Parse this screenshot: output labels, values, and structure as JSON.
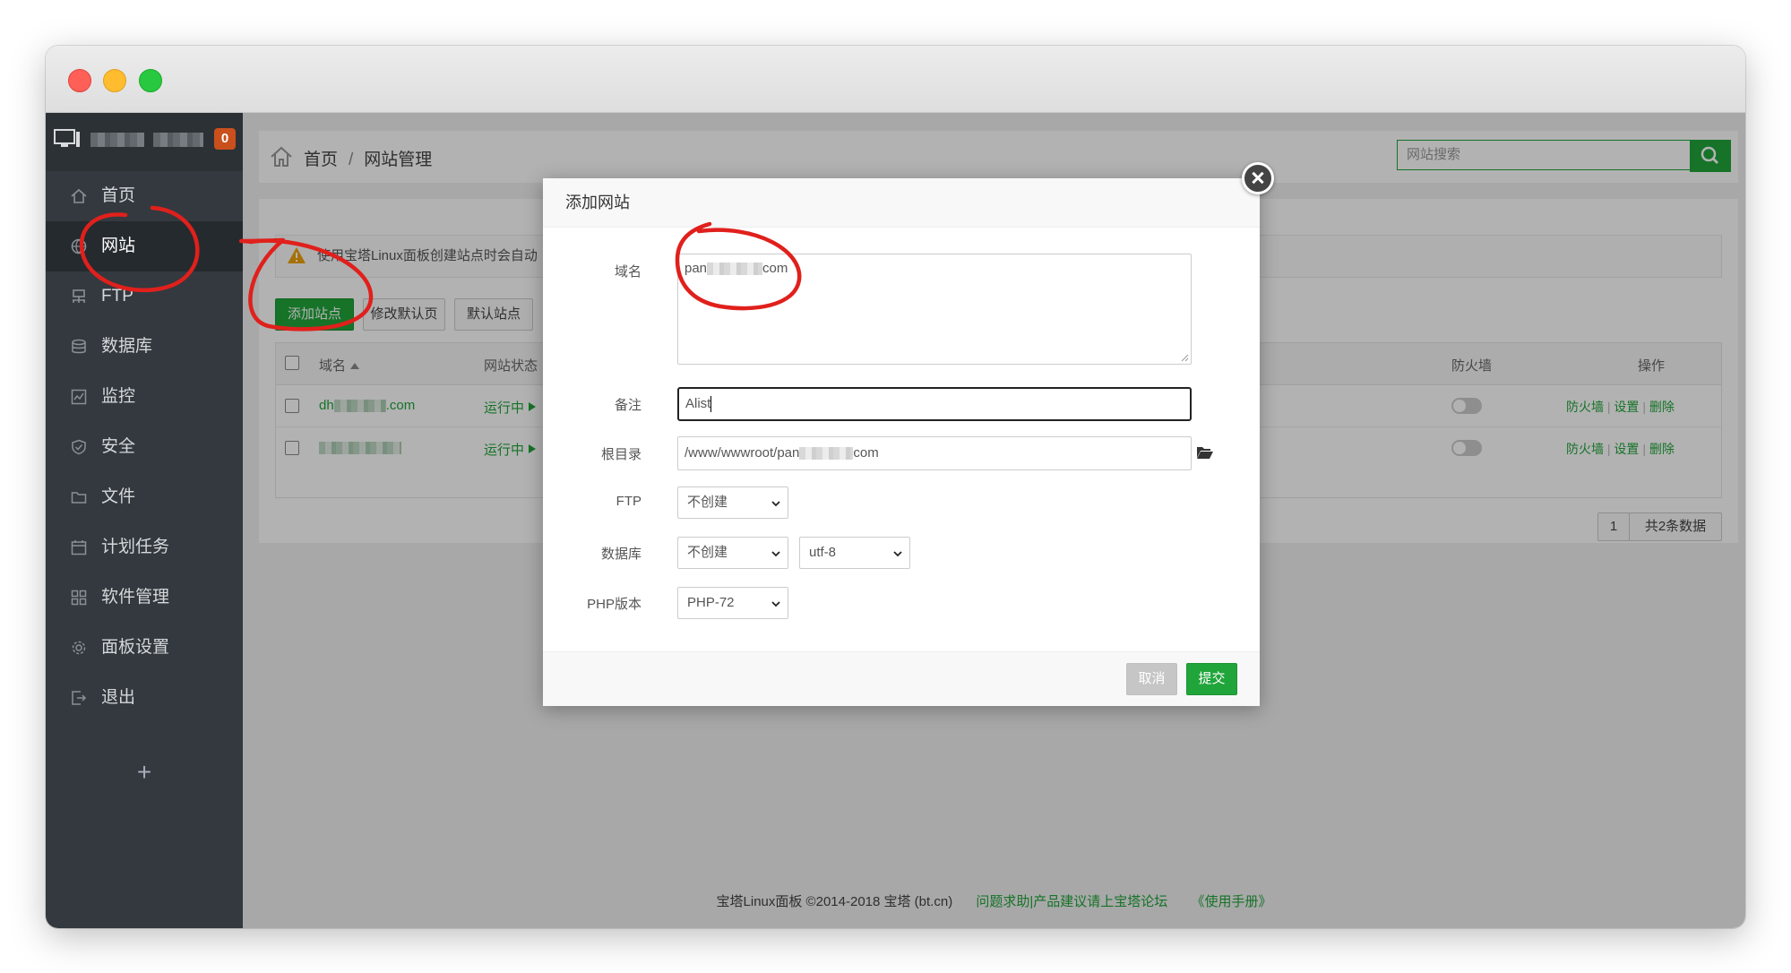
{
  "sidebar": {
    "badge_count": "0",
    "items": [
      {
        "label": "首页"
      },
      {
        "label": "网站"
      },
      {
        "label": "FTP"
      },
      {
        "label": "数据库"
      },
      {
        "label": "监控"
      },
      {
        "label": "安全"
      },
      {
        "label": "文件"
      },
      {
        "label": "计划任务"
      },
      {
        "label": "软件管理"
      },
      {
        "label": "面板设置"
      },
      {
        "label": "退出"
      }
    ],
    "add_symbol": "+"
  },
  "breadcrumb": {
    "home": "首页",
    "separator": "/",
    "current": "网站管理"
  },
  "search": {
    "placeholder": "网站搜索"
  },
  "notice": {
    "text": "使用宝塔Linux面板创建站点时会自动"
  },
  "toolbar": {
    "add_site": "添加站点",
    "edit_default": "修改默认页",
    "default_site": "默认站点"
  },
  "table": {
    "headers": {
      "domain": "域名",
      "status": "网站状态",
      "firewall": "防火墙",
      "actions": "操作"
    },
    "rows": [
      {
        "domain_prefix": "dh",
        "domain_suffix": ".com",
        "status": "运行中",
        "actions": [
          "防火墙",
          "设置",
          "删除"
        ]
      },
      {
        "domain_prefix": "",
        "domain_suffix": "",
        "status": "运行中",
        "actions": [
          "防火墙",
          "设置",
          "删除"
        ]
      }
    ],
    "action_sep": "|"
  },
  "pager": {
    "page": "1",
    "total": "共2条数据"
  },
  "footer": {
    "copyright": "宝塔Linux面板 ©2014-2018 宝塔 (bt.cn)",
    "forum": "问题求助|产品建议请上宝塔论坛",
    "manual": "《使用手册》"
  },
  "modal": {
    "title": "添加网站",
    "domain_label": "域名",
    "domain_value_prefix": "pan",
    "domain_value_suffix": "com",
    "remark_label": "备注",
    "remark_value": "Alist",
    "root_label": "根目录",
    "root_value_prefix": "/www/wwwroot/pan",
    "root_value_suffix": "com",
    "ftp_label": "FTP",
    "ftp_value": "不创建",
    "db_label": "数据库",
    "db_value": "不创建",
    "db_charset": "utf-8",
    "php_label": "PHP版本",
    "php_value": "PHP-72",
    "cancel": "取消",
    "submit": "提交"
  },
  "colors": {
    "accent": "#20a53a",
    "sidebar": "#33393f",
    "badge": "#c9501d",
    "annotation": "#e0201c"
  }
}
